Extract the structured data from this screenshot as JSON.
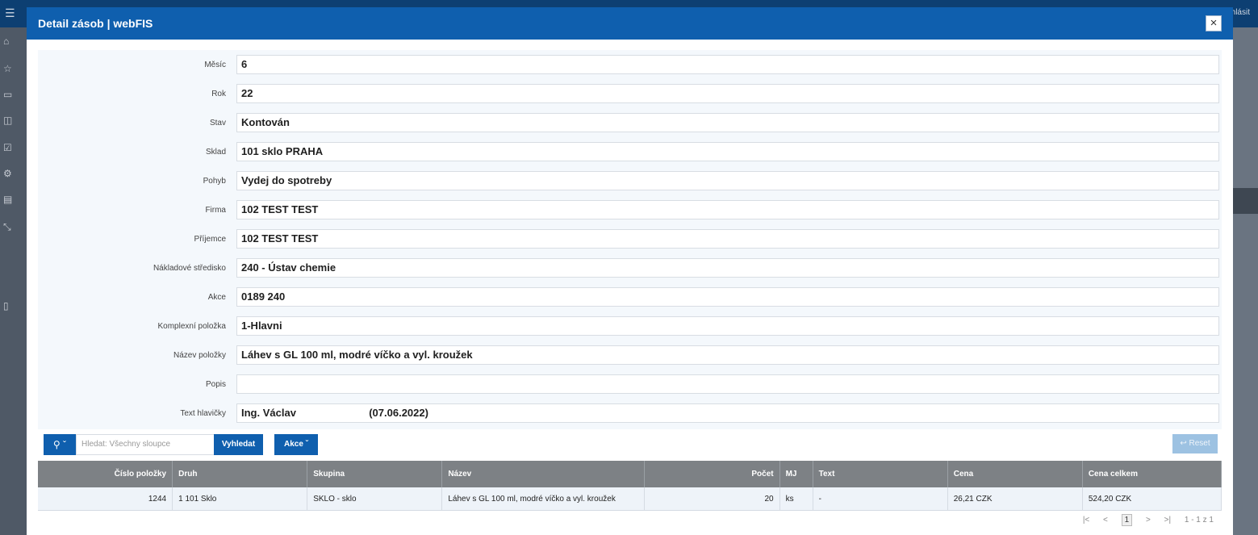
{
  "app": {
    "logout_label": "hlásit"
  },
  "modal": {
    "title": "Detail zásob | webFIS"
  },
  "form": [
    {
      "label": "Měsíc",
      "value": "6"
    },
    {
      "label": "Rok",
      "value": "22"
    },
    {
      "label": "Stav",
      "value": "Kontován"
    },
    {
      "label": "Sklad",
      "value": "101 sklo PRAHA"
    },
    {
      "label": "Pohyb",
      "value": "Vydej do spotreby"
    },
    {
      "label": "Firma",
      "value": "102 TEST TEST"
    },
    {
      "label": "Příjemce",
      "value": "102 TEST TEST"
    },
    {
      "label": "Nákladové středisko",
      "value": "240 - Ústav chemie"
    },
    {
      "label": "Akce",
      "value": "0189 240"
    },
    {
      "label": "Komplexní položka",
      "value": "1-Hlavni"
    },
    {
      "label": "Název položky",
      "value": "Láhev s GL 100 ml, modré víčko a vyl. kroužek"
    },
    {
      "label": "Popis",
      "value": ""
    },
    {
      "label": "Text hlavičky",
      "value": "Ing. Václav                         (07.06.2022)"
    }
  ],
  "toolbar": {
    "search_placeholder": "Hledat: Všechny sloupce",
    "find_label": "Vyhledat",
    "actions_label": "Akce",
    "reset_label": "Reset"
  },
  "table": {
    "headers": [
      "Číslo položky",
      "Druh",
      "Skupina",
      "Název",
      "Počet",
      "MJ",
      "Text",
      "Cena",
      "Cena celkem"
    ],
    "rows": [
      [
        "1244",
        "1 101 Sklo",
        "SKLO - sklo",
        "Láhev s GL 100 ml, modré víčko a vyl. kroužek",
        "20",
        "ks",
        "-",
        "26,21 CZK",
        "524,20 CZK"
      ]
    ]
  },
  "pager": {
    "current_page": "1",
    "summary": "1 - 1 z 1"
  },
  "icons": {
    "search": "search-icon",
    "close": "close-icon",
    "reset": "reset-icon"
  }
}
